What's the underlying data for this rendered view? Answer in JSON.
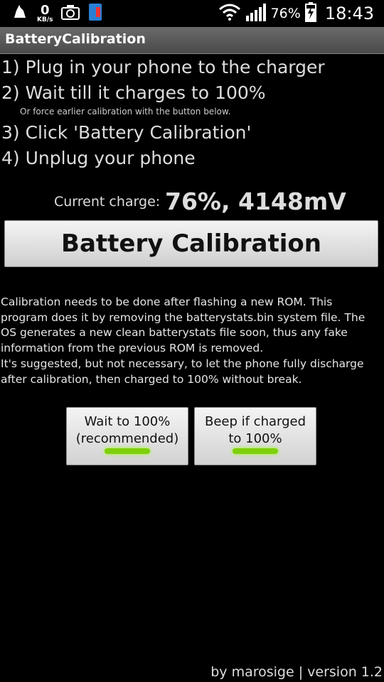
{
  "status_bar": {
    "net_speed_value": "0",
    "net_speed_unit": "KB/s",
    "battery_percent": "76%",
    "time": "18:43"
  },
  "app": {
    "title": "BatteryCalibration"
  },
  "steps": [
    "1) Plug in your phone to the charger",
    "2) Wait till it charges to 100%",
    "3) Click 'Battery Calibration'",
    "4) Unplug your phone"
  ],
  "step_note": "Or force earlier calibration with the button below.",
  "charge": {
    "label": "Current charge:",
    "value": "76%, 4148mV"
  },
  "calibration_button_label": "Battery Calibration",
  "description": [
    "Calibration needs to be done after flashing a new ROM. This program does it by removing the batterystats.bin system file. The OS generates a new clean batterystats file soon, thus any fake information from the previous ROM is removed.",
    "It's suggested, but not necessary, to let the phone fully discharge after calibration, then charged to 100% without break."
  ],
  "toggles": {
    "wait": {
      "line1": "Wait to 100%",
      "line2": "(recommended)",
      "on": true
    },
    "beep": {
      "line1": "Beep if charged",
      "line2": "to 100%",
      "on": true
    }
  },
  "footer": "by marosige | version 1.2",
  "colors": {
    "background": "#000000",
    "title_bar": "#5a5a5a",
    "toggle_on": "#7ed00a"
  }
}
